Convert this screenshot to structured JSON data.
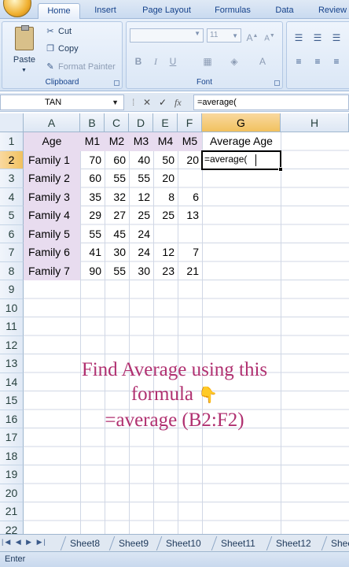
{
  "ribbon": {
    "tabs": [
      "Home",
      "Insert",
      "Page Layout",
      "Formulas",
      "Data",
      "Review"
    ],
    "active_tab": "Home",
    "clipboard": {
      "paste": "Paste",
      "cut": "Cut",
      "copy": "Copy",
      "format_painter": "Format Painter",
      "group_label": "Clipboard"
    },
    "font": {
      "size": "11",
      "bold": "B",
      "italic": "I",
      "underline": "U",
      "group_label": "Font"
    }
  },
  "formula_bar": {
    "name_box": "TAN",
    "fx": "fx",
    "content": "=average("
  },
  "grid": {
    "columns": [
      "A",
      "B",
      "C",
      "D",
      "E",
      "F",
      "G",
      "H"
    ],
    "selected_column": "G",
    "rows": [
      "1",
      "2",
      "3",
      "4",
      "5",
      "6",
      "7",
      "8",
      "9",
      "10",
      "11",
      "12",
      "13",
      "14",
      "15",
      "16",
      "17",
      "18",
      "19",
      "20",
      "21",
      "22"
    ],
    "selected_row": "2",
    "header_row": [
      "Age",
      "M1",
      "M2",
      "M3",
      "M4",
      "M5",
      "Average Age"
    ],
    "data": [
      [
        "Family 1",
        "70",
        "60",
        "40",
        "50",
        "20"
      ],
      [
        "Family 2",
        "60",
        "55",
        "55",
        "20",
        ""
      ],
      [
        "Family 3",
        "35",
        "32",
        "12",
        "8",
        "6"
      ],
      [
        "Family 4",
        "29",
        "27",
        "25",
        "25",
        "13"
      ],
      [
        "Family 5",
        "55",
        "45",
        "24",
        "",
        ""
      ],
      [
        "Family 6",
        "41",
        "30",
        "24",
        "12",
        "7"
      ],
      [
        "Family 7",
        "90",
        "55",
        "30",
        "23",
        "21"
      ]
    ],
    "active_cell_value": "=average("
  },
  "overlay": {
    "line1": "Find Average using this",
    "line2": "formula",
    "line3": "=average (B2:F2)",
    "icon": "pointing-down-hand-icon"
  },
  "sheets": [
    "Sheet8",
    "Sheet9",
    "Sheet10",
    "Sheet11",
    "Sheet12",
    "Shee"
  ],
  "status": "Enter"
}
